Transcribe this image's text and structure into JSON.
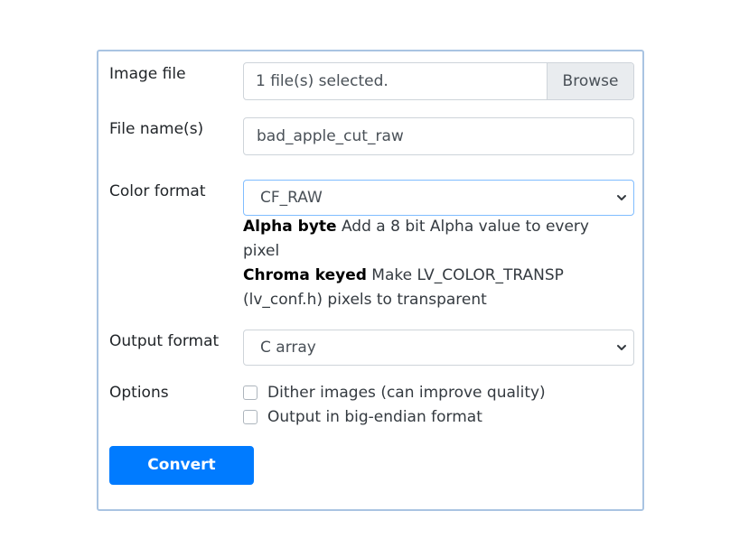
{
  "form": {
    "image_file": {
      "label": "Image file",
      "value": "1 file(s) selected.",
      "browse_label": "Browse"
    },
    "file_name": {
      "label": "File name(s)",
      "value": "bad_apple_cut_raw"
    },
    "color_format": {
      "label": "Color format",
      "selected": "CF_RAW",
      "help": {
        "alpha_title": "Alpha byte",
        "alpha_text": " Add a 8 bit Alpha value to every pixel",
        "chroma_title": "Chroma keyed",
        "chroma_text": " Make LV_COLOR_TRANSP (lv_conf.h) pixels to transparent"
      }
    },
    "output_format": {
      "label": "Output format",
      "selected": "C array"
    },
    "options": {
      "label": "Options",
      "dither_label": "Dither images (can improve quality)",
      "bigendian_label": "Output in big-endian format"
    },
    "convert_label": "Convert"
  },
  "icons": {
    "select": "chevron-down-icon"
  },
  "colors": {
    "accent": "#007bff",
    "panel_border": "#a9c4e2",
    "focus_border": "#80bdff"
  }
}
